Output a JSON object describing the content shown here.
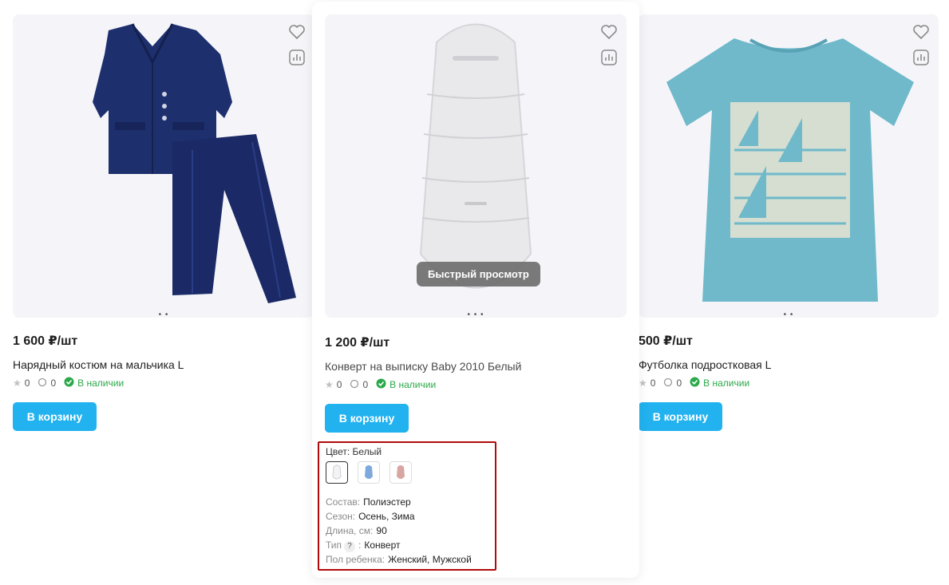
{
  "products": [
    {
      "price": "1 600 ₽/шт",
      "title": "Нарядный костюм на мальчика L",
      "rating": "0",
      "reviews": "0",
      "stock": "В наличии",
      "cart_label": "В корзину"
    },
    {
      "price": "1 200 ₽/шт",
      "title": "Конверт на выписку Baby 2010 Белый",
      "rating": "0",
      "reviews": "0",
      "stock": "В наличии",
      "cart_label": "В корзину",
      "quick_view_label": "Быстрый просмотр",
      "color_label": "Цвет: Белый",
      "swatch_colors": [
        "#f3f3f5",
        "#7da9dd",
        "#d8a5a2"
      ],
      "props": [
        {
          "key": "Состав:",
          "value": "Полиэстер"
        },
        {
          "key": "Сезон:",
          "value": "Осень, Зима"
        },
        {
          "key": "Длина, см:",
          "value": "90"
        },
        {
          "key": "Тип",
          "help": "?",
          "sep": ":",
          "value": "Конверт"
        },
        {
          "key": "Пол ребенка:",
          "value": "Женский, Мужской"
        }
      ]
    },
    {
      "price": "500 ₽/шт",
      "title": "Футболка подростковая L",
      "rating": "0",
      "reviews": "0",
      "stock": "В наличии",
      "cart_label": "В корзину"
    }
  ],
  "colors": {
    "accent": "#21b2ef",
    "stock": "#2ba94a",
    "highlight_border": "#b00a0a"
  }
}
